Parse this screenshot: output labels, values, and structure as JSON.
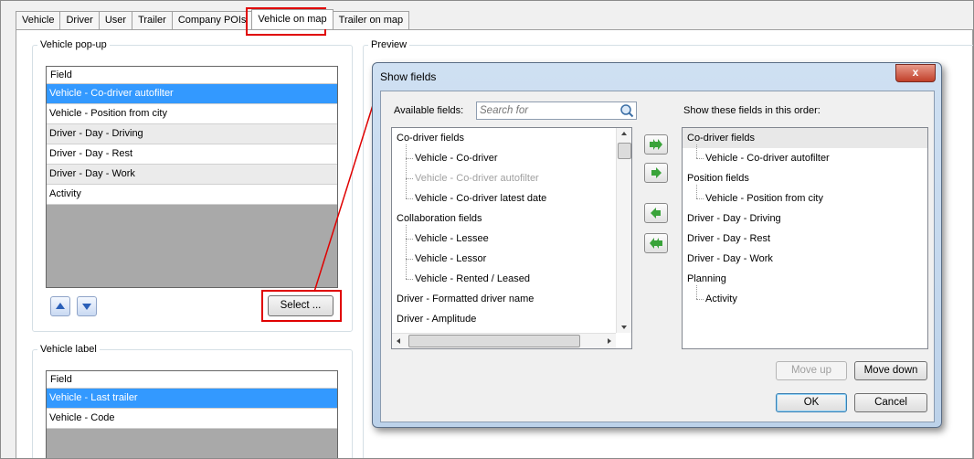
{
  "tabs": [
    "Vehicle",
    "Driver",
    "User",
    "Trailer",
    "Company POIs",
    "Vehicle on map",
    "Trailer on map"
  ],
  "active_tab": "Vehicle on map",
  "popup": {
    "legend": "Vehicle pop-up",
    "header": "Field",
    "rows": [
      "Vehicle - Co-driver autofilter",
      "Vehicle - Position from city",
      "Driver - Day - Driving",
      "Driver - Day - Rest",
      "Driver - Day - Work",
      "Activity"
    ],
    "select_label": "Select ..."
  },
  "label_section": {
    "legend": "Vehicle label",
    "header": "Field",
    "rows": [
      "Vehicle - Last trailer",
      "Vehicle - Code"
    ]
  },
  "preview_legend": "Preview",
  "dialog": {
    "title": "Show fields",
    "close": "x",
    "available_label": "Available fields:",
    "search_placeholder": "Search for",
    "available": [
      {
        "text": "Co-driver fields",
        "level": 0
      },
      {
        "text": "Vehicle - Co-driver",
        "level": 1
      },
      {
        "text": "Vehicle - Co-driver autofilter",
        "level": 1,
        "disabled": true
      },
      {
        "text": "Vehicle - Co-driver latest date",
        "level": 1
      },
      {
        "text": "Collaboration fields",
        "level": 0
      },
      {
        "text": "Vehicle - Lessee",
        "level": 1
      },
      {
        "text": "Vehicle - Lessor",
        "level": 1
      },
      {
        "text": "Vehicle - Rented / Leased",
        "level": 1
      },
      {
        "text": "Driver - Formatted driver name",
        "level": 0
      },
      {
        "text": "Driver - Amplitude",
        "level": 0
      }
    ],
    "order_label": "Show these fields in this order:",
    "order": [
      {
        "text": "Co-driver fields",
        "level": 0
      },
      {
        "text": "Vehicle - Co-driver autofilter",
        "level": 1
      },
      {
        "text": "Position fields",
        "level": 0
      },
      {
        "text": "Vehicle - Position from city",
        "level": 1
      },
      {
        "text": "Driver - Day - Driving",
        "level": 0
      },
      {
        "text": "Driver - Day - Rest",
        "level": 0
      },
      {
        "text": "Driver - Day - Work",
        "level": 0
      },
      {
        "text": "Planning",
        "level": 0
      },
      {
        "text": "Activity",
        "level": 1
      }
    ],
    "move_up": "Move up",
    "move_down": "Move down",
    "ok": "OK",
    "cancel": "Cancel"
  },
  "colors": {
    "selection": "#3399ff",
    "highlight": "#e00000"
  },
  "icons": [
    "arrow-up-icon",
    "arrow-down-icon",
    "search-icon",
    "add-all-icon",
    "add-icon",
    "remove-icon",
    "remove-all-icon",
    "close-icon"
  ]
}
